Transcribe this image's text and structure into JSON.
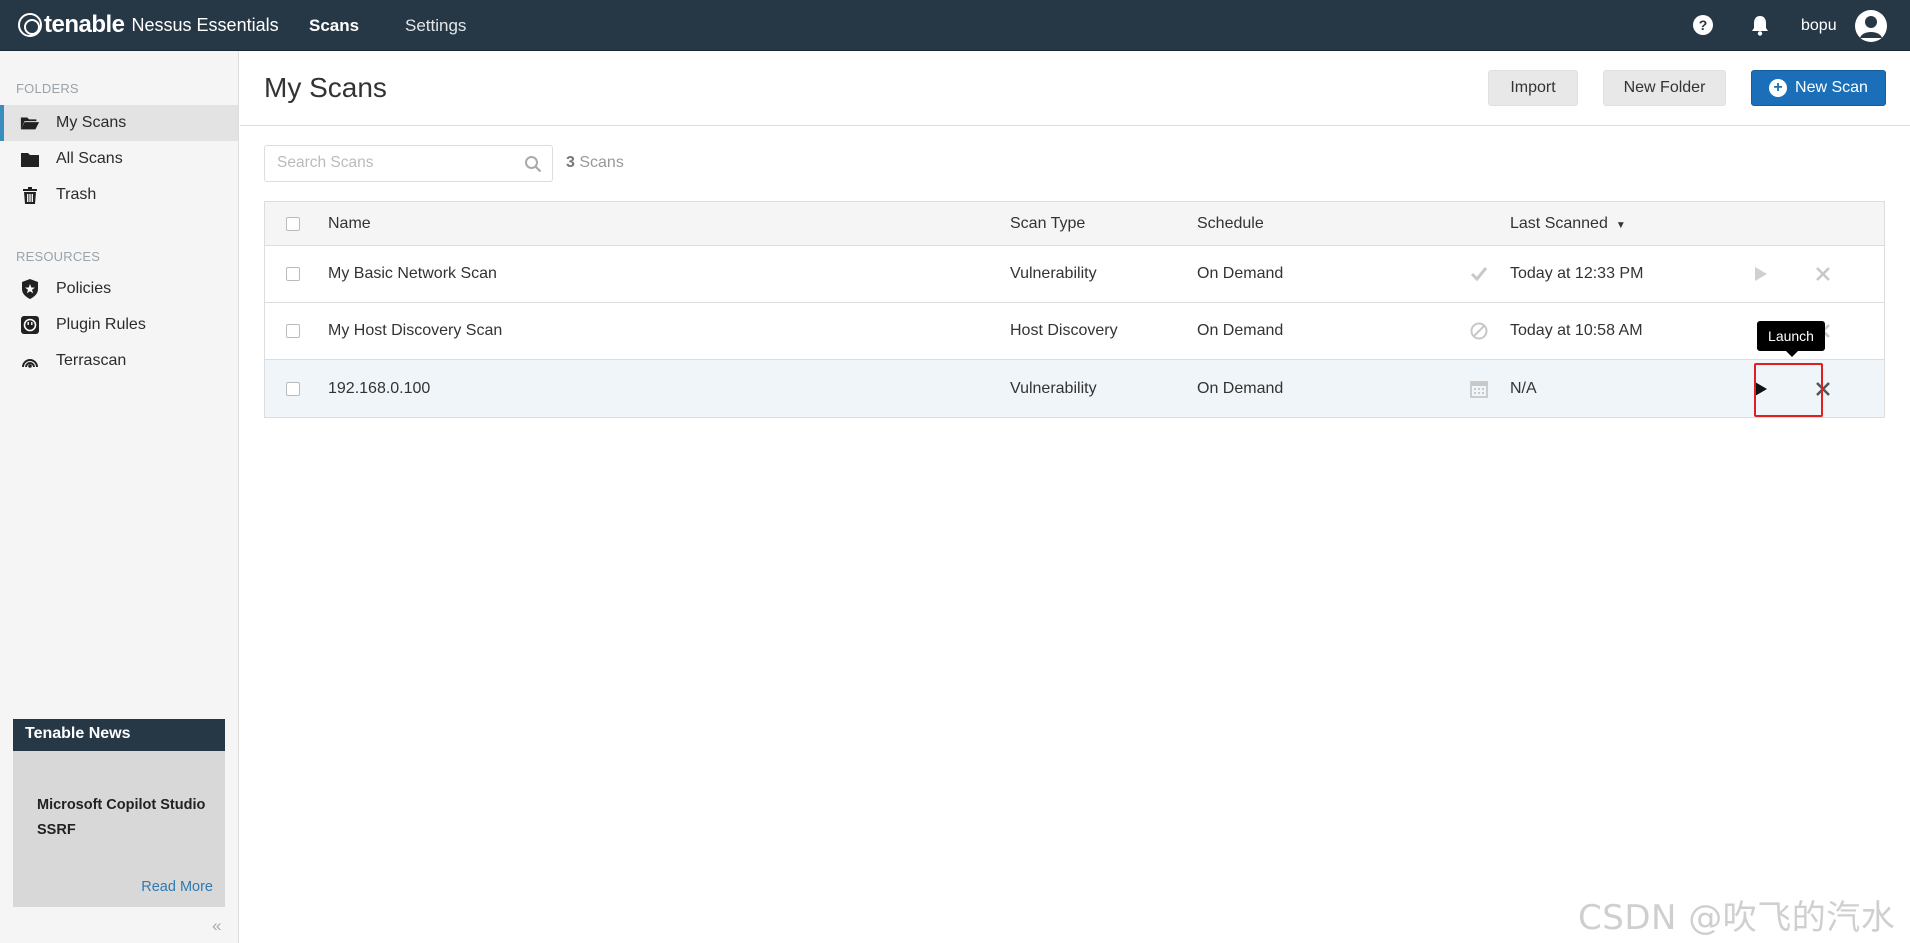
{
  "topbar": {
    "brand": "tenable",
    "product": "Nessus Essentials",
    "nav_scans": "Scans",
    "nav_settings": "Settings",
    "help": "?",
    "username": "bopu"
  },
  "sidebar": {
    "folders_header": "FOLDERS",
    "folders": [
      {
        "label": "My Scans",
        "icon": "folder-open-icon"
      },
      {
        "label": "All Scans",
        "icon": "folder-icon"
      },
      {
        "label": "Trash",
        "icon": "trash-icon"
      }
    ],
    "resources_header": "RESOURCES",
    "resources": [
      {
        "label": "Policies",
        "icon": "policy-badge-icon"
      },
      {
        "label": "Plugin Rules",
        "icon": "plugin-icon"
      },
      {
        "label": "Terrascan",
        "icon": "terrascan-icon"
      }
    ],
    "news": {
      "header": "Tenable News",
      "title": "Microsoft Copilot Studio SSRF",
      "read_more": "Read More"
    },
    "collapse": "«"
  },
  "main": {
    "title": "My Scans",
    "import_label": "Import",
    "new_folder_label": "New Folder",
    "new_scan_label": "New Scan",
    "search_placeholder": "Search Scans",
    "scan_count": "3",
    "scan_count_suffix": "Scans"
  },
  "table": {
    "headers": {
      "name": "Name",
      "type": "Scan Type",
      "schedule": "Schedule",
      "last": "Last Scanned",
      "sort": "▼"
    },
    "rows": [
      {
        "name": "My Basic Network Scan",
        "type": "Vulnerability",
        "schedule": "On Demand",
        "status_icon": "check-icon",
        "last": "Today at 12:33 PM"
      },
      {
        "name": "My Host Discovery Scan",
        "type": "Host Discovery",
        "schedule": "On Demand",
        "status_icon": "canceled-icon",
        "last": "Today at 10:58 AM"
      },
      {
        "name": "192.168.0.100",
        "type": "Vulnerability",
        "schedule": "On Demand",
        "status_icon": "calendar-icon",
        "last": "N/A"
      }
    ]
  },
  "tooltip": "Launch",
  "watermark": "CSDN @吹飞的汽水",
  "colors": {
    "topbar": "#263746",
    "accent": "#1a6fb8",
    "highlight_box": "#e02020"
  }
}
